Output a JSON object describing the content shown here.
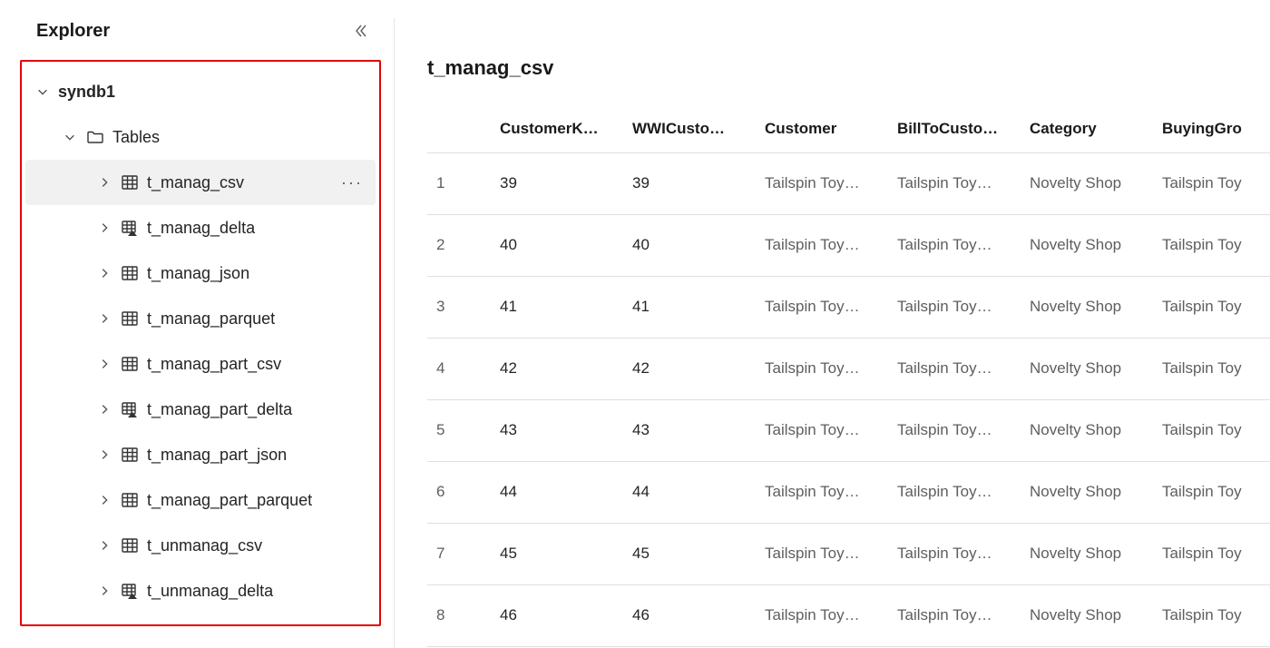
{
  "sidebar": {
    "title": "Explorer",
    "db": {
      "name": "syndb1",
      "expanded": true
    },
    "folder": {
      "name": "Tables",
      "expanded": true
    },
    "tables": [
      {
        "name": "t_manag_csv",
        "icon": "table",
        "selected": true,
        "more": true
      },
      {
        "name": "t_manag_delta",
        "icon": "table-delta"
      },
      {
        "name": "t_manag_json",
        "icon": "table"
      },
      {
        "name": "t_manag_parquet",
        "icon": "table"
      },
      {
        "name": "t_manag_part_csv",
        "icon": "table"
      },
      {
        "name": "t_manag_part_delta",
        "icon": "table-delta"
      },
      {
        "name": "t_manag_part_json",
        "icon": "table"
      },
      {
        "name": "t_manag_part_parquet",
        "icon": "table"
      },
      {
        "name": "t_unmanag_csv",
        "icon": "table"
      },
      {
        "name": "t_unmanag_delta",
        "icon": "table-delta"
      }
    ]
  },
  "main": {
    "title": "t_manag_csv",
    "columns": [
      "CustomerK…",
      "WWICusto…",
      "Customer",
      "BillToCusto…",
      "Category",
      "BuyingGro"
    ],
    "rows": [
      {
        "idx": "1",
        "cells": [
          "39",
          "39",
          "Tailspin Toy…",
          "Tailspin Toy…",
          "Novelty Shop",
          "Tailspin Toy"
        ]
      },
      {
        "idx": "2",
        "cells": [
          "40",
          "40",
          "Tailspin Toy…",
          "Tailspin Toy…",
          "Novelty Shop",
          "Tailspin Toy"
        ]
      },
      {
        "idx": "3",
        "cells": [
          "41",
          "41",
          "Tailspin Toy…",
          "Tailspin Toy…",
          "Novelty Shop",
          "Tailspin Toy"
        ]
      },
      {
        "idx": "4",
        "cells": [
          "42",
          "42",
          "Tailspin Toy…",
          "Tailspin Toy…",
          "Novelty Shop",
          "Tailspin Toy"
        ]
      },
      {
        "idx": "5",
        "cells": [
          "43",
          "43",
          "Tailspin Toy…",
          "Tailspin Toy…",
          "Novelty Shop",
          "Tailspin Toy"
        ]
      },
      {
        "idx": "6",
        "cells": [
          "44",
          "44",
          "Tailspin Toy…",
          "Tailspin Toy…",
          "Novelty Shop",
          "Tailspin Toy"
        ]
      },
      {
        "idx": "7",
        "cells": [
          "45",
          "45",
          "Tailspin Toy…",
          "Tailspin Toy…",
          "Novelty Shop",
          "Tailspin Toy"
        ]
      },
      {
        "idx": "8",
        "cells": [
          "46",
          "46",
          "Tailspin Toy…",
          "Tailspin Toy…",
          "Novelty Shop",
          "Tailspin Toy"
        ]
      }
    ]
  },
  "glyphs": {
    "more": "···"
  }
}
